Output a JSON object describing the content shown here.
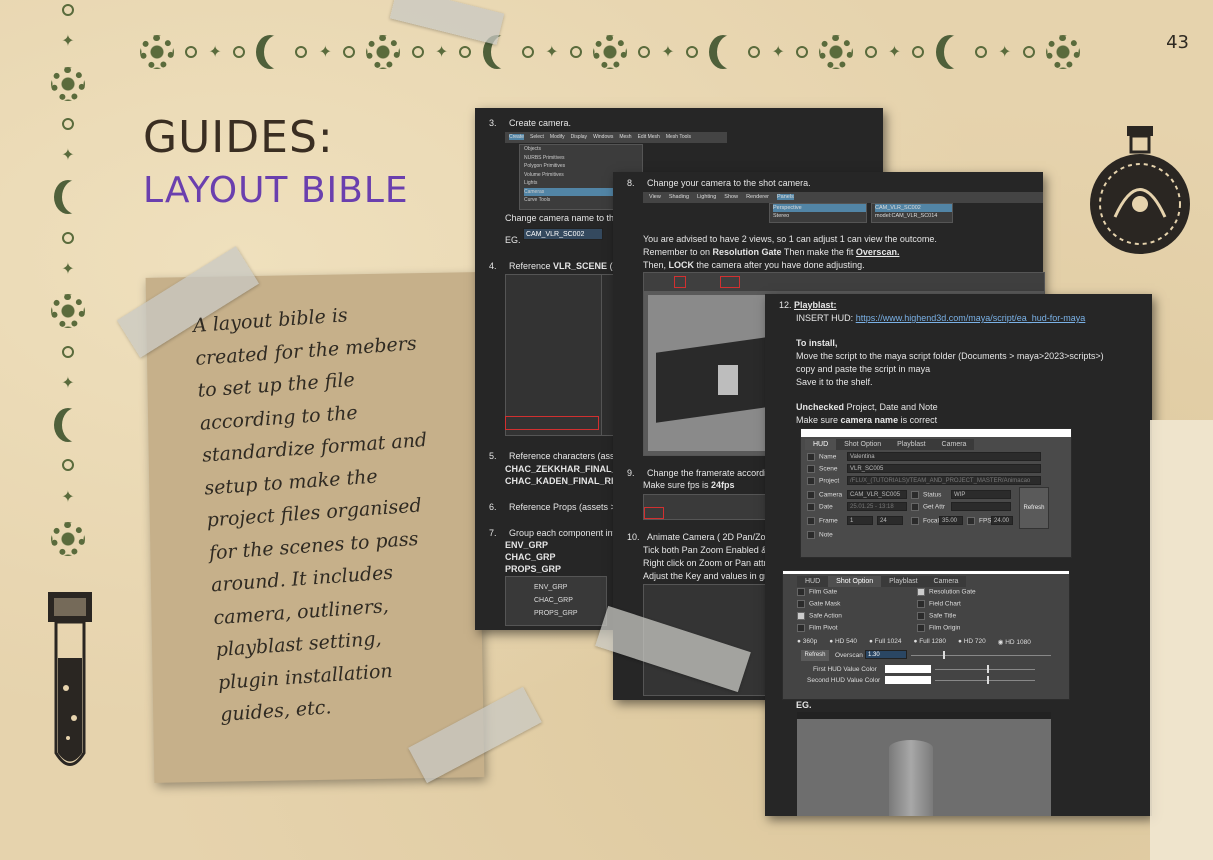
{
  "page_number": "43",
  "title": "GUIDES:",
  "subtitle": "LAYOUT BIBLE",
  "note_lines": [
    "A layout bible is",
    "created for the mebers",
    "to set up the file",
    "according to the",
    "standardize format and",
    "setup to make the",
    "project files organised",
    "for the scenes to pass",
    "around. It includes",
    "camera, outliners,",
    "playblast setting,",
    "plugin installation",
    "guides, etc."
  ],
  "doc1": {
    "step3": "Create camera.",
    "menu": [
      "Create",
      "Select",
      "Modify",
      "Display",
      "Windows",
      "Mesh",
      "Edit Mesh",
      "Mesh Tools",
      "Mesh"
    ],
    "submenu": [
      "Objects",
      "NURBS Primitives",
      "Polygon Primitives",
      "Volume Primitives",
      "Lights",
      "Cameras",
      "Curve Tools"
    ],
    "rename": "Change camera name to the",
    "eg": "EG.",
    "cam_field": "CAM_VLR_SC002",
    "step4": "Reference ",
    "step4_bold": "VLR_SCENE",
    "step4_rest": " (asse",
    "step5": "Reference characters (asset",
    "chac1": "CHAC_ZEKKHAR_FINAL_RIG",
    "chac2": "CHAC_KADEN_FINAL_RIG",
    "step6": "Reference Props (assets > P",
    "step7": "Group each component into",
    "grp1": "ENV_GRP",
    "grp2": "CHAC_GRP",
    "grp3": "PROPS_GRP",
    "outliner": [
      "ENV_GRP",
      "CHAC_GRP",
      "PROPS_GRP"
    ]
  },
  "doc2": {
    "step8": "Change your camera to the shot camera.",
    "menu": [
      "View",
      "Shading",
      "Lighting",
      "Show",
      "Renderer",
      "Panels"
    ],
    "menu_r": [
      "View",
      "Shading",
      "Lighting",
      "Show"
    ],
    "panel_items": [
      "Perspective",
      "Stereo"
    ],
    "panel_items_r": [
      "CAM_VLR_SC002",
      "model:CAM_VLR_SC014"
    ],
    "p1": "You are advised to have 2 views, so 1 can adjust 1 can view the outcome.",
    "p2a": "Remember to on ",
    "p2b": "Resolution Gate",
    "p2c": " Then make the fit ",
    "p2d": "Overscan.",
    "p3a": "Then, ",
    "p3b": "LOCK",
    "p3c": " the camera after you have done adjusting.",
    "step9": "Change the framerate according",
    "fps_a": "Make sure fps is ",
    "fps_b": "24fps",
    "step10a": "Animate Camera ( 2D Pan/Zoom",
    "step10b": "Tick both Pan Zoom Enabled & R",
    "step10c": "Right click on Zoom or Pan attrib",
    "step10d": "Adjust the Key and values in gra"
  },
  "doc3": {
    "step12": "Playblast:",
    "insert_label": "INSERT HUD: ",
    "insert_link": "https://www.highend3d.com/maya/script/ea_hud-for-maya",
    "install_h": "To install,",
    "install1": "Move the script to the maya script folder (Documents > maya>2023>scripts>)",
    "install2": "copy and paste the script in maya",
    "install3": "Save it to the shelf.",
    "unchecked_b": "Unchecked",
    "unchecked_r": " Project, Date and Note",
    "make_a": "Make sure ",
    "make_b": "camera name",
    "make_c": " is correct",
    "hud_tabs": [
      "HUD",
      "Shot Option",
      "Playblast",
      "Camera"
    ],
    "hud_rows": [
      {
        "label": "Name",
        "value": "Valentina"
      },
      {
        "label": "Scene",
        "value": "VLR_SC005"
      },
      {
        "label": "Project",
        "value": "/FLUX_(TUTORIALS)/TEAM_AND_PROJECT_MASTER/Animacao"
      },
      {
        "label": "Camera",
        "value": "CAM_VLR_SC005"
      },
      {
        "label": "Date",
        "value": "25.01.25 - 13:18"
      },
      {
        "label": "Frame",
        "value": "1"
      },
      {
        "label": "Note",
        "value": ""
      }
    ],
    "status_label": "Status",
    "status_value": "WIP",
    "getattr": "Get Attr",
    "focal_label": "Focal",
    "focal_value": "35.00",
    "fps_label": "FPS",
    "fps_value": "24.00",
    "frame_end": "24",
    "refresh": "Refresh",
    "shot_tabs": [
      "HUD",
      "Shot Option",
      "Playblast",
      "Camera"
    ],
    "shot_left": [
      "Film Gate",
      "Gate Mask",
      "Safe Action",
      "Film Pivot"
    ],
    "shot_right": [
      "Resolution Gate",
      "Field Chart",
      "Safe Title",
      "Film Origin"
    ],
    "res": [
      "360p",
      "HD 540",
      "Full 1024",
      "Full 1280",
      "HD 720",
      "HD 1080"
    ],
    "refresh2": "Refresh",
    "overscan_label": "Overscan",
    "overscan_value": "1.30",
    "first_hud": "First HUD Value Color",
    "second_hud": "Second HUD Value Color",
    "eg": "EG."
  }
}
